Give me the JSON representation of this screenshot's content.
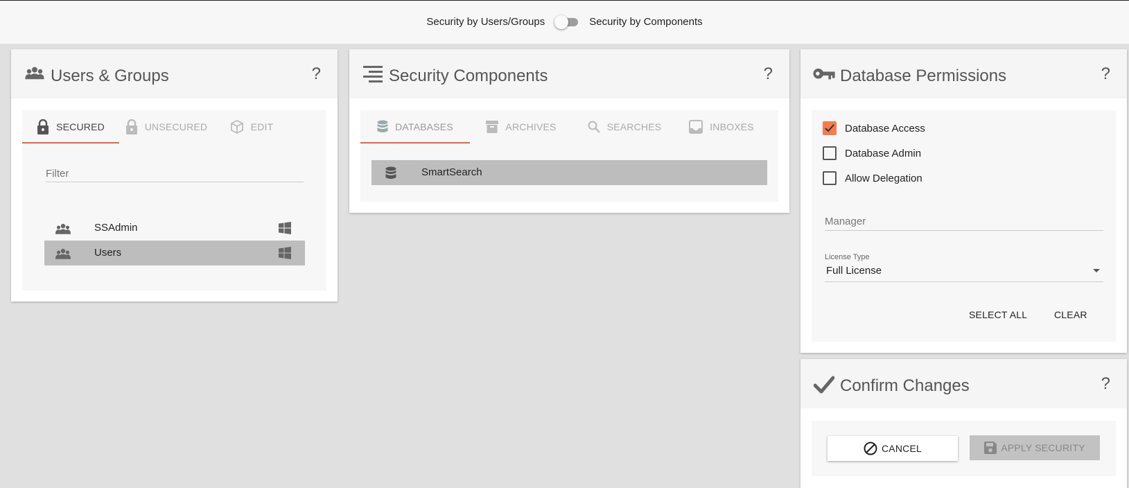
{
  "mode_toggle": {
    "left_label": "Security by Users/Groups",
    "right_label": "Security by Components"
  },
  "users_groups": {
    "title": "Users & Groups",
    "help": "?",
    "tabs": [
      {
        "label": "SECURED",
        "icon": "lock-icon",
        "active": true
      },
      {
        "label": "UNSECURED",
        "icon": "unlock-icon",
        "active": false
      },
      {
        "label": "EDIT",
        "icon": "cube-icon",
        "active": false
      }
    ],
    "filter_placeholder": "Filter",
    "items": [
      {
        "label": "SSAdmin",
        "icon": "group-icon",
        "badge_icon": "windows-icon",
        "selected": false
      },
      {
        "label": "Users",
        "icon": "group-icon",
        "badge_icon": "windows-icon",
        "selected": true
      }
    ]
  },
  "security_components": {
    "title": "Security Components",
    "help": "?",
    "tabs": [
      {
        "label": "DATABASES",
        "icon": "database-icon",
        "active": true
      },
      {
        "label": "ARCHIVES",
        "icon": "archive-icon",
        "active": false
      },
      {
        "label": "SEARCHES",
        "icon": "search-icon",
        "active": false
      },
      {
        "label": "INBOXES",
        "icon": "inbox-icon",
        "active": false
      }
    ],
    "items": [
      {
        "label": "SmartSearch",
        "icon": "database-icon",
        "selected": true
      }
    ]
  },
  "database_permissions": {
    "title": "Database Permissions",
    "help": "?",
    "checkboxes": [
      {
        "label": "Database Access",
        "checked": true
      },
      {
        "label": "Database Admin",
        "checked": false
      },
      {
        "label": "Allow Delegation",
        "checked": false
      }
    ],
    "manager_placeholder": "Manager",
    "license_type_label": "License Type",
    "license_type_value": "Full License",
    "select_all_label": "SELECT ALL",
    "clear_label": "CLEAR"
  },
  "confirm_changes": {
    "title": "Confirm Changes",
    "help": "?",
    "cancel_label": "CANCEL",
    "apply_label": "APPLY SECURITY"
  },
  "colors": {
    "accent": "#e8643c",
    "checkbox_checked": "#f37b52",
    "selected_row": "#bdbdbd",
    "icon_gray": "#666666"
  }
}
